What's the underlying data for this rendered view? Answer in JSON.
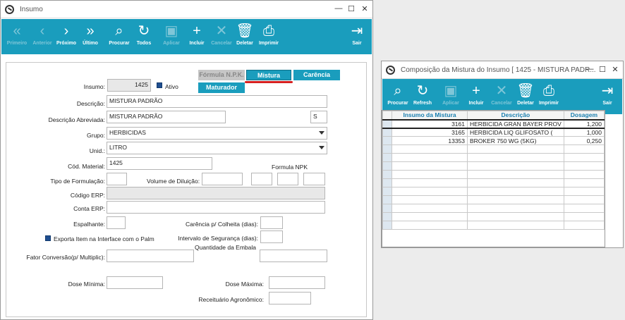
{
  "insumo_window": {
    "title": "Insumo",
    "toolbar": [
      {
        "label": "Primeiro",
        "icon": "double-chevron-left-icon",
        "glyph": "«",
        "enabled": false
      },
      {
        "label": "Anterior",
        "icon": "chevron-left-icon",
        "glyph": "‹",
        "enabled": false
      },
      {
        "label": "Próximo",
        "icon": "chevron-right-icon",
        "glyph": "›",
        "enabled": true
      },
      {
        "label": "Último",
        "icon": "double-chevron-right-icon",
        "glyph": "»",
        "enabled": true
      },
      {
        "label": "Procurar",
        "icon": "search-icon",
        "glyph": "⌕",
        "enabled": true
      },
      {
        "label": "Todos",
        "icon": "refresh-icon",
        "glyph": "↻",
        "enabled": true
      },
      {
        "label": "Aplicar",
        "icon": "save-icon",
        "glyph": "▣",
        "enabled": false
      },
      {
        "label": "Incluir",
        "icon": "plus-icon",
        "glyph": "+",
        "enabled": true
      },
      {
        "label": "Cancelar",
        "icon": "close-icon",
        "glyph": "✕",
        "enabled": false
      },
      {
        "label": "Deletar",
        "icon": "trash-icon",
        "glyph": "🗑",
        "enabled": true
      },
      {
        "label": "Imprimir",
        "icon": "print-icon",
        "glyph": "⎙",
        "enabled": true
      },
      {
        "label": "Sair",
        "icon": "exit-icon",
        "glyph": "⇥",
        "enabled": true
      }
    ],
    "tabs": {
      "formula_npk": "Fórmula N.P.K.",
      "mistura": "Mistura",
      "carencia": "Carência",
      "maturador": "Maturador"
    },
    "form": {
      "insumo_label": "Insumo:",
      "insumo_value": "1425",
      "ativo_label": "Ativo",
      "descricao_label": "Descrição:",
      "descricao_value": "MISTURA PADRÃO",
      "descricao_abrev_label": "Descrição Abreviada:",
      "descricao_abrev_value": "MISTURA PADRÃO",
      "abrev_code": "S",
      "grupo_label": "Grupo:",
      "grupo_value": "HERBICIDAS",
      "unid_label": "Unid.:",
      "unid_value": "LITRO",
      "cod_material_label": "Cód. Material:",
      "cod_material_value": "1425",
      "formula_npk_label": "Formula NPK",
      "tipo_formulacao_label": "Tipo de Formulação:",
      "volume_diluicao_label": "Volume de Diluição:",
      "codigo_erp_label": "Código ERP:",
      "conta_erp_label": "Conta ERP:",
      "espalhante_label": "Espalhante:",
      "carencia_colheita_label": "Carência p/ Colheita (dias):",
      "exporta_label": "Exporta Item na Interface com o Palm",
      "intervalo_seguranca_label": "Intervalo de Segurança (dias):",
      "quantidade_embala_label": "Quantidade da Embala",
      "fator_conversao_label": "Fator Conversão(p/ Multiplic):",
      "dose_minima_label": "Dose Mínima:",
      "dose_maxima_label": "Dose Máxima:",
      "receituario_label": "Receituário Agronômico:"
    }
  },
  "mistura_window": {
    "title": "Composição da Mistura do Insumo [ 1425 - MISTURA PADR...",
    "toolbar": [
      {
        "label": "Procurar",
        "icon": "search-icon",
        "glyph": "⌕",
        "enabled": true
      },
      {
        "label": "Refresh",
        "icon": "refresh-icon",
        "glyph": "↻",
        "enabled": true
      },
      {
        "label": "Aplicar",
        "icon": "save-icon",
        "glyph": "▣",
        "enabled": false
      },
      {
        "label": "Incluir",
        "icon": "plus-icon",
        "glyph": "+",
        "enabled": true
      },
      {
        "label": "Cancelar",
        "icon": "close-icon",
        "glyph": "✕",
        "enabled": false
      },
      {
        "label": "Deletar",
        "icon": "trash-icon",
        "glyph": "🗑",
        "enabled": true
      },
      {
        "label": "Imprimir",
        "icon": "print-icon",
        "glyph": "⎙",
        "enabled": true
      },
      {
        "label": "Sair",
        "icon": "exit-icon",
        "glyph": "⇥",
        "enabled": true
      }
    ],
    "columns": [
      "Insumo da Mistura",
      "Descrição",
      "Dosagem"
    ],
    "rows": [
      [
        "3161",
        "HERBICIDA GRAN BAYER PROV",
        "1,200"
      ],
      [
        "3165",
        "HERBICIDA LIQ GLIFOSATO (",
        "1,000"
      ],
      [
        "13353",
        "BROKER 750 WG (5KG)",
        "0,250"
      ]
    ]
  }
}
